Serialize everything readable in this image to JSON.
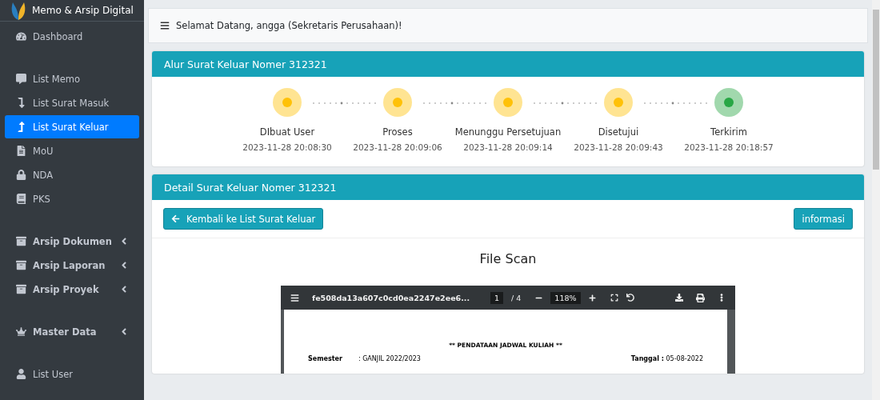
{
  "brand": {
    "title": "Memo & Arsip Digital"
  },
  "sidebar": {
    "groups": [
      {
        "items": [
          {
            "label": "Dashboard",
            "kind": "link",
            "selected": false
          }
        ]
      },
      {
        "items": [
          {
            "label": "List Memo",
            "kind": "link",
            "selected": false
          },
          {
            "label": "List Surat Masuk",
            "kind": "link",
            "selected": false
          },
          {
            "label": "List Surat Keluar",
            "kind": "link",
            "selected": true
          },
          {
            "label": "MoU",
            "kind": "link",
            "selected": false
          },
          {
            "label": "NDA",
            "kind": "link",
            "selected": false
          },
          {
            "label": "PKS",
            "kind": "link",
            "selected": false
          }
        ]
      },
      {
        "items": [
          {
            "label": "Arsip Dokumen",
            "kind": "menu",
            "selected": false
          },
          {
            "label": "Arsip Laporan",
            "kind": "menu",
            "selected": false
          },
          {
            "label": "Arsip Proyek",
            "kind": "menu",
            "selected": false
          }
        ]
      },
      {
        "items": [
          {
            "label": "Master Data",
            "kind": "menu",
            "selected": false
          }
        ]
      },
      {
        "items": [
          {
            "label": "List User",
            "kind": "link",
            "selected": false
          }
        ]
      }
    ]
  },
  "topbar": {
    "greeting": "Selamat Datang, angga (Sekretaris Perusahaan)!"
  },
  "flow_card": {
    "title": "Alur Surat Keluar Nomer 312321",
    "steps": [
      {
        "label": "DIbuat User",
        "time": "2023-11-28 20:08:30",
        "color": "#ffc107"
      },
      {
        "label": "Proses",
        "time": "2023-11-28 20:09:06",
        "color": "#ffc107"
      },
      {
        "label": "Menunggu Persetujuan",
        "time": "2023-11-28 20:09:14",
        "color": "#ffc107"
      },
      {
        "label": "Disetujui",
        "time": "2023-11-28 20:09:43",
        "color": "#ffc107"
      },
      {
        "label": "Terkirim",
        "time": "2023-11-28 20:18:57",
        "color": "#28a745"
      }
    ]
  },
  "detail_card": {
    "title": "Detail Surat Keluar Nomer 312321",
    "back_button": "Kembali ke List Surat Keluar",
    "info_button": "informasi",
    "section_title": "File Scan",
    "pdf_viewer": {
      "filename": "fe508da13a607c0cd0ea2247e2ee6...",
      "page": "1",
      "pages": "/ 4",
      "zoom": "118%",
      "document": {
        "heading": "** PENDATAAN JADWAL KULIAH **",
        "semester_label": "Semester",
        "semester_value": ": GANJIL 2022/2023",
        "date": "**Tanggal :** 05-08-2022"
      }
    }
  }
}
